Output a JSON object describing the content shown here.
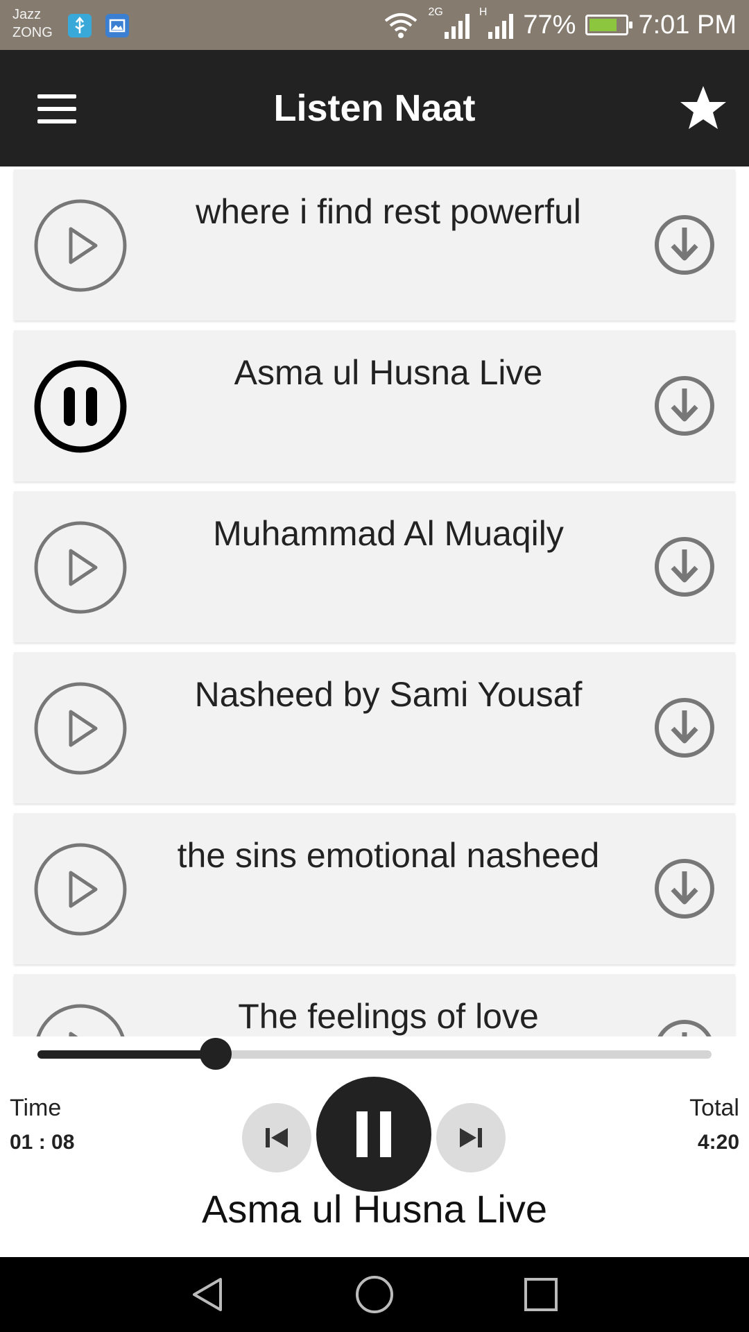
{
  "status_bar": {
    "carrier_1": "Jazz",
    "carrier_2": "ZONG",
    "network_2g": "2G",
    "network_h": "H",
    "battery": "77%",
    "time": "7:01 PM"
  },
  "app_bar": {
    "title": "Listen Naat",
    "menu_icon": "hamburger-menu-icon",
    "favorite_icon": "star-icon"
  },
  "tracks": [
    {
      "title": "where i find rest powerful",
      "state": "play"
    },
    {
      "title": "Asma ul Husna Live",
      "state": "pause"
    },
    {
      "title": "Muhammad Al Muaqily",
      "state": "play"
    },
    {
      "title": "Nasheed by Sami Yousaf",
      "state": "play"
    },
    {
      "title": "the sins emotional nasheed",
      "state": "play"
    },
    {
      "title": "The feelings of love",
      "state": "play"
    }
  ],
  "player": {
    "time_label": "Time",
    "time_value": "01 : 08",
    "total_label": "Total",
    "total_value": "4:20",
    "progress": 0.264,
    "now_playing": "Asma ul Husna Live",
    "prev_icon": "skip-previous-icon",
    "main_icon": "pause-icon",
    "next_icon": "skip-next-icon"
  },
  "colors": {
    "status_bar": "#857b6f",
    "app_bar": "#222222",
    "list_item_bg": "#f2f2f2",
    "icon_gray": "#777777",
    "battery_green": "#8cc63f"
  }
}
